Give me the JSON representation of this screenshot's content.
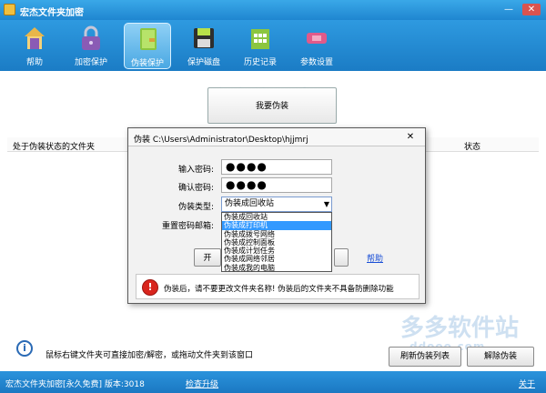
{
  "window": {
    "title": "宏杰文件夹加密",
    "min_glyph": "—",
    "close_glyph": "✕"
  },
  "toolbar": {
    "items": [
      {
        "label": "帮助",
        "icon": "house-icon",
        "active": false
      },
      {
        "label": "加密保护",
        "icon": "lock-icon",
        "active": false
      },
      {
        "label": "伪装保护",
        "icon": "notebook-icon",
        "active": true
      },
      {
        "label": "保护磁盘",
        "icon": "floppy-icon",
        "active": false
      },
      {
        "label": "历史记录",
        "icon": "calendar-icon",
        "active": false
      },
      {
        "label": "参数设置",
        "icon": "wrench-icon",
        "active": false
      }
    ]
  },
  "main": {
    "disguise_button": "我要伪装",
    "list_headers": [
      "处于伪装状态的文件夹",
      "状态"
    ],
    "tip": "鼠标右键文件夹可直接加密/解密，或拖动文件夹到该窗口",
    "refresh_button": "刷新伪装列表",
    "release_button": "解除伪装",
    "watermark_cn": "多多软件站",
    "watermark_en": "ddooo.com",
    "info_glyph": "i"
  },
  "dialog": {
    "title": "伪装 C:\\Users\\Administrator\\Desktop\\hjjmrj",
    "close_glyph": "✕",
    "password_label": "输入密码:",
    "password_value": "●●●●",
    "confirm_label": "确认密码:",
    "confirm_value": "●●●●",
    "type_label": "伪装类型:",
    "type_selected": "伪装成回收站",
    "type_options": [
      "伪装成回收站",
      "伪装成打印机",
      "伪装成拨号网络",
      "伪装成控制面板",
      "伪装成计划任务",
      "伪装成网络邻居",
      "伪装成我的电脑"
    ],
    "type_highlighted_index": 1,
    "email_label": "重置密码邮箱:",
    "ok_button": "开",
    "help_link": "帮助",
    "warning_glyph": "!",
    "warning": "伪装后，请不要更改文件夹名称! 伪装后的文件夹不具备防删除功能"
  },
  "statusbar": {
    "version": "宏杰文件夹加密[永久免费] 版本:3018",
    "update_link": "检查升级",
    "about_link": "关于"
  },
  "colors": {
    "title_blue": "#1f86d0",
    "active_tab": "#8fd0f5",
    "link_blue": "#1a4fd6",
    "warning_red": "#d9251d",
    "dropdown_highlight": "#3399ff"
  }
}
